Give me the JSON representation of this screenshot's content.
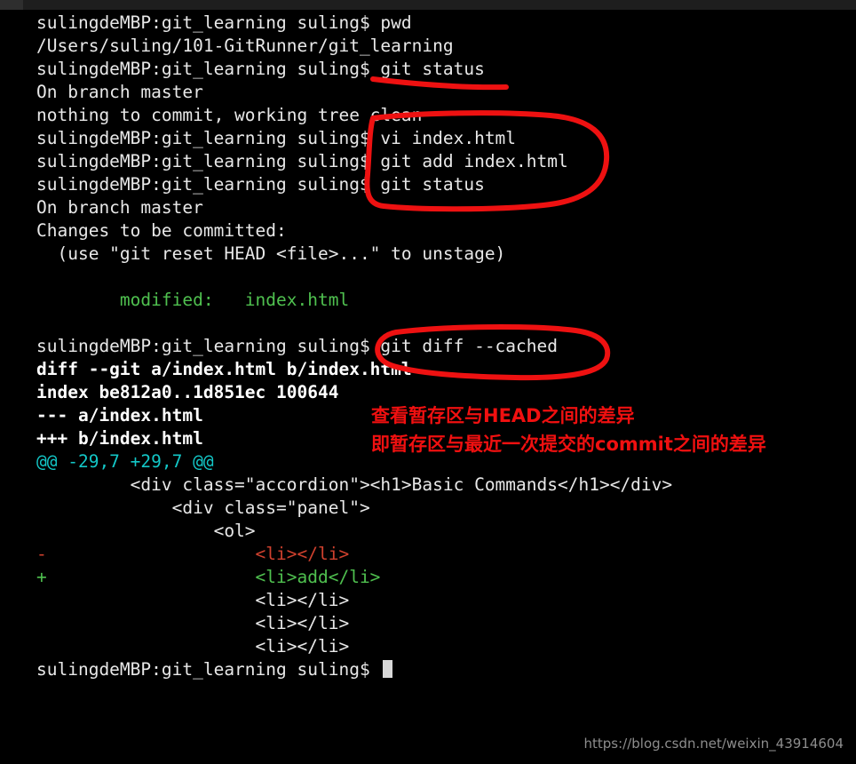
{
  "window": {
    "topbar_color": "#1e1e1e",
    "background": "#000000"
  },
  "terminal": {
    "prompt": "sulingdeMBP:git_learning suling$ ",
    "foreground": "#e8e8e8",
    "lines": [
      {
        "id": "l01",
        "text": "sulingdeMBP:git_learning suling$ pwd",
        "style": "white"
      },
      {
        "id": "l02",
        "text": "/Users/suling/101-GitRunner/git_learning",
        "style": "white"
      },
      {
        "id": "l03",
        "text": "sulingdeMBP:git_learning suling$ git status",
        "style": "white"
      },
      {
        "id": "l04",
        "text": "On branch master",
        "style": "white"
      },
      {
        "id": "l05",
        "text": "nothing to commit, working tree clean",
        "style": "white"
      },
      {
        "id": "l06",
        "text": "sulingdeMBP:git_learning suling$ vi index.html",
        "style": "white"
      },
      {
        "id": "l07",
        "text": "sulingdeMBP:git_learning suling$ git add index.html",
        "style": "white"
      },
      {
        "id": "l08",
        "text": "sulingdeMBP:git_learning suling$ git status",
        "style": "white"
      },
      {
        "id": "l09",
        "text": "On branch master",
        "style": "white"
      },
      {
        "id": "l10",
        "text": "Changes to be committed:",
        "style": "white"
      },
      {
        "id": "l11",
        "text": "  (use \"git reset HEAD <file>...\" to unstage)",
        "style": "white"
      },
      {
        "id": "l12",
        "text": "",
        "style": "blank"
      },
      {
        "id": "l13",
        "text": "        modified:   index.html",
        "style": "green"
      },
      {
        "id": "l14",
        "text": "",
        "style": "blank"
      },
      {
        "id": "l15",
        "text": "sulingdeMBP:git_learning suling$ git diff --cached",
        "style": "white"
      },
      {
        "id": "l16",
        "text": "diff --git a/index.html b/index.html",
        "style": "bold"
      },
      {
        "id": "l17",
        "text": "index be812a0..1d851ec 100644",
        "style": "bold"
      },
      {
        "id": "l18",
        "text": "--- a/index.html",
        "style": "bold"
      },
      {
        "id": "l19",
        "text": "+++ b/index.html",
        "style": "bold"
      },
      {
        "id": "l20",
        "text": "@@ -29,7 +29,7 @@",
        "style": "cyan"
      },
      {
        "id": "l21",
        "text": "         <div class=\"accordion\"><h1>Basic Commands</h1></div>",
        "style": "white"
      },
      {
        "id": "l22",
        "text": "             <div class=\"panel\">",
        "style": "white"
      },
      {
        "id": "l23",
        "text": "                 <ol>",
        "style": "white"
      },
      {
        "id": "l24",
        "text": "-                    <li></li>",
        "style": "red"
      },
      {
        "id": "l25",
        "text": "+                    <li>add</li>",
        "style": "green"
      },
      {
        "id": "l26",
        "text": "                     <li></li>",
        "style": "white"
      },
      {
        "id": "l27",
        "text": "                     <li></li>",
        "style": "white"
      },
      {
        "id": "l28",
        "text": "                     <li></li>",
        "style": "white"
      },
      {
        "id": "l29",
        "text": "sulingdeMBP:git_learning suling$ ",
        "style": "white",
        "cursor": true
      }
    ]
  },
  "annotations": {
    "color": "#ee1111",
    "underline_label": "underline under git status",
    "circle_1_label": "circle around vi / git add / git status commands",
    "circle_2_label": "circle around git diff --cached",
    "notes": [
      "查看暂存区与HEAD之间的差异",
      "即暂存区与最近一次提交的commit之间的差异"
    ]
  },
  "watermark": {
    "text": "https://blog.csdn.net/weixin_43914604",
    "color": "#8d8d8d"
  }
}
